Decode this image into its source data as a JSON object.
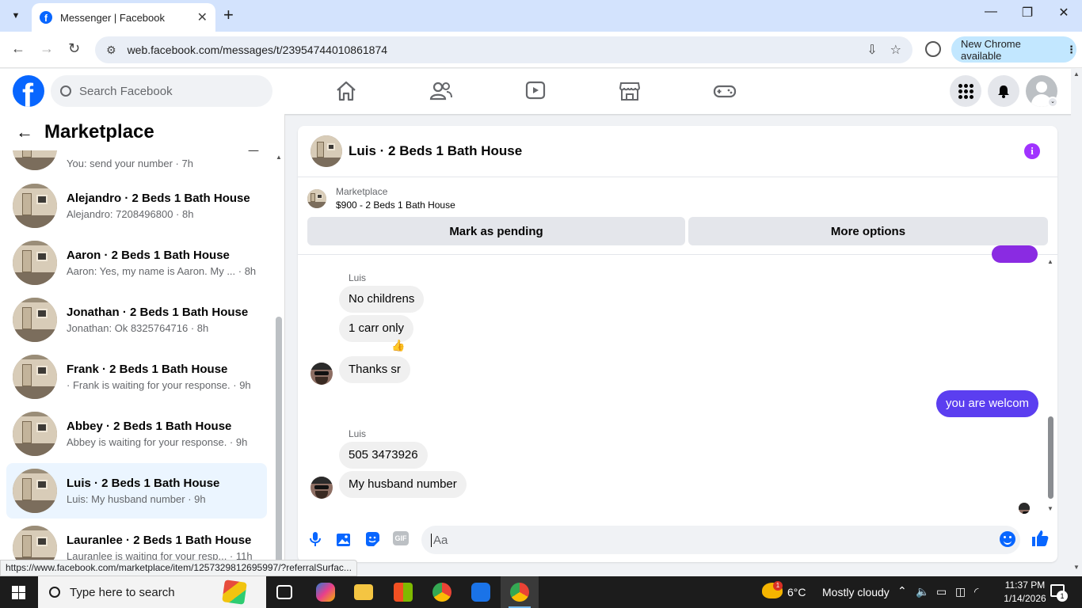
{
  "browser": {
    "tab_title": "Messenger | Facebook",
    "url": "web.facebook.com/messages/t/23954744010861874",
    "new_chrome_label": "New Chrome available",
    "status_url": "https://www.facebook.com/marketplace/item/1257329812695997/?referralSurfac..."
  },
  "fb_header": {
    "search_placeholder": "Search Facebook",
    "brand_color": "#0866ff"
  },
  "left_panel": {
    "title": "Marketplace",
    "conversations": [
      {
        "name": "",
        "preview": "You: send your number · 7h"
      },
      {
        "name": "Alejandro · 2 Beds 1 Bath House",
        "preview": "Alejandro: 7208496800 · 8h"
      },
      {
        "name": "Aaron · 2 Beds 1 Bath House",
        "preview": "Aaron: Yes, my name is Aaron. My ... · 8h"
      },
      {
        "name": "Jonathan · 2 Beds 1 Bath House",
        "preview": "Jonathan: Ok 8325764716 · 8h"
      },
      {
        "name": "Frank · 2 Beds 1 Bath House",
        "preview": " · Frank is waiting for your response. · 9h"
      },
      {
        "name": "Abbey · 2 Beds 1 Bath House",
        "preview": "Abbey is waiting for your response. · 9h"
      },
      {
        "name": "Luis · 2 Beds 1 Bath House",
        "preview": "Luis: My husband number · 9h",
        "active": true
      },
      {
        "name": "Lauranlee · 2 Beds 1 Bath House",
        "preview": "Lauranlee is waiting for your resp... · 11h"
      }
    ]
  },
  "chat": {
    "title": "Luis · 2 Beds 1 Bath House",
    "marketplace_label": "Marketplace",
    "listing": "$900 - 2 Beds 1 Bath House",
    "mark_pending": "Mark as pending",
    "more_options": "More options",
    "messages": [
      {
        "sender": "Luis"
      },
      {
        "text": "No childrens",
        "from": "them"
      },
      {
        "text": "1 carr only",
        "from": "them",
        "reaction": "👍"
      },
      {
        "text": "Thanks sr",
        "from": "them"
      },
      {
        "text": "you are welcom",
        "from": "me"
      },
      {
        "sender": "Luis"
      },
      {
        "text": "505 3473926",
        "from": "them"
      },
      {
        "text": "My husband number",
        "from": "them"
      }
    ],
    "composer_placeholder": "Aa",
    "gif_label": "GIF",
    "my_bubble_color": "#5b3ef0"
  },
  "taskbar": {
    "search_placeholder": "Type here to search",
    "weather_temp": "6°C",
    "weather_desc": "Mostly cloudy",
    "weather_badge": "1",
    "time": "11:37 PM",
    "date": "1/14/2026",
    "notif_count": "1"
  }
}
